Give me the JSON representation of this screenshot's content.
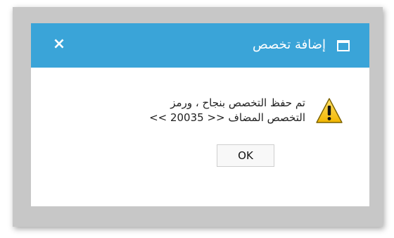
{
  "dialog": {
    "title": "إضافة تخصص",
    "close_label": "×",
    "message_line1": "تم حفظ التخصص بنجاح ، ورمز",
    "message_line2": "التخصص المضاف << 20035 >>",
    "ok_label": "OK"
  },
  "colors": {
    "titlebar": "#3aa4d8",
    "frame": "#c7c7c7",
    "warning_yellow": "#f5c400"
  },
  "icons": {
    "title": "window-icon",
    "close": "close-icon",
    "message": "warning-icon"
  }
}
